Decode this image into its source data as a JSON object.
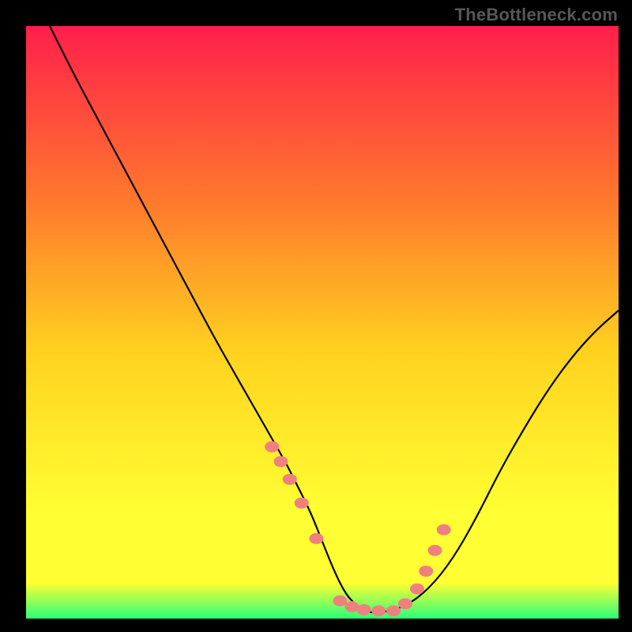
{
  "watermark": "TheBottleneck.com",
  "colors": {
    "gradient_top": "#ff1f4b",
    "gradient_mid1": "#ff7a2d",
    "gradient_mid2": "#ffd21f",
    "gradient_mid3": "#ffff33",
    "gradient_bottom": "#2bff7a",
    "curve": "#000000",
    "dot": "#f08080",
    "frame": "#000000"
  },
  "chart_data": {
    "type": "line",
    "title": "",
    "xlabel": "",
    "ylabel": "",
    "xlim": [
      0,
      100
    ],
    "ylim": [
      0,
      100
    ],
    "series": [
      {
        "name": "curve",
        "x": [
          4,
          8,
          12,
          16,
          20,
          24,
          28,
          32,
          36,
          40,
          42,
          44,
          46,
          48,
          50,
          52,
          54,
          56,
          58,
          60,
          64,
          68,
          72,
          76,
          80,
          84,
          88,
          92,
          96,
          100
        ],
        "y": [
          100,
          92,
          84.5,
          77,
          69.5,
          62,
          54.5,
          47,
          40,
          33,
          29.5,
          26,
          22,
          18,
          13,
          8,
          4,
          2,
          1,
          1,
          2,
          5,
          10,
          17,
          25,
          32,
          38.5,
          44,
          48.5,
          52
        ]
      }
    ],
    "dots": {
      "name": "highlight-points",
      "x": [
        41.5,
        43,
        44.5,
        46.5,
        49,
        53,
        55,
        57,
        59.5,
        62,
        64,
        66,
        67.5,
        69,
        70.5
      ],
      "y": [
        29,
        26.5,
        23.5,
        19.5,
        13.5,
        3,
        2,
        1.5,
        1.3,
        1.3,
        2.5,
        5,
        8,
        11.5,
        15
      ]
    },
    "legend": null,
    "grid": false
  }
}
